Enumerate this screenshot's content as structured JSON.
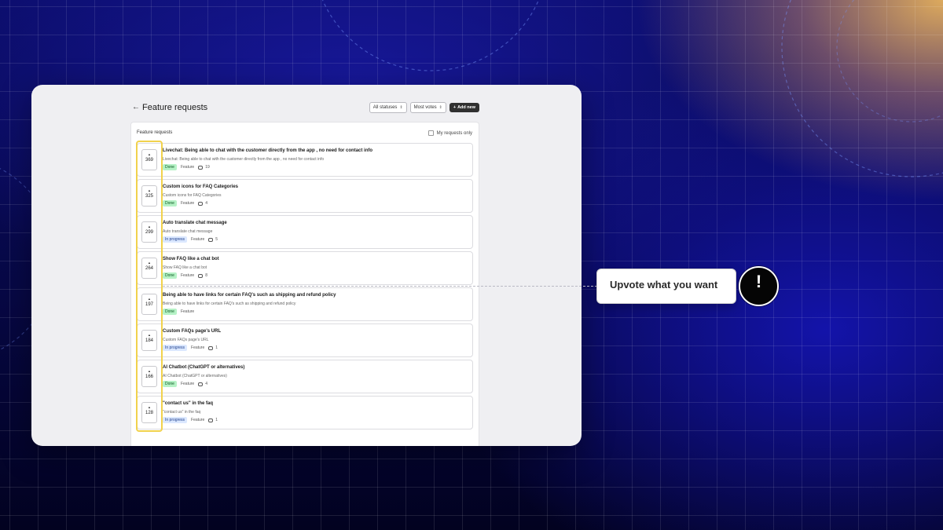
{
  "header": {
    "back_icon": "arrow-left-icon",
    "title": "Feature requests",
    "status_filter": "All statuses",
    "sort_filter": "Most votes",
    "add_button": "Add new"
  },
  "panel": {
    "title": "Feature requests",
    "my_requests_label": "My requests only"
  },
  "items": [
    {
      "votes": "369",
      "title": "Livechat: Being able to chat with the customer directly from the app , no need for contact info",
      "desc": "Livechat: Being able to chat with the customer directly from the app , no need for contact info",
      "status": "Done",
      "type": "Feature",
      "comments": "19"
    },
    {
      "votes": "325",
      "title": "Custom icons for FAQ Categories",
      "desc": "Custom icons for FAQ Categories",
      "status": "Done",
      "type": "Feature",
      "comments": "4"
    },
    {
      "votes": "299",
      "title": "Auto translate chat message",
      "desc": "Auto translate chat message",
      "status": "In progress",
      "type": "Feature",
      "comments": "5"
    },
    {
      "votes": "264",
      "title": "Show FAQ like a chat bot",
      "desc": "Show FAQ like a chat bot",
      "status": "Done",
      "type": "Feature",
      "comments": "8"
    },
    {
      "votes": "197",
      "title": "Being able to have links for certain FAQ's such as shipping and refund policy",
      "desc": "Being able to have links for certain FAQ's such as shipping and refund policy",
      "status": "Done",
      "type": "Feature",
      "comments": ""
    },
    {
      "votes": "184",
      "title": "Custom FAQs page's URL",
      "desc": "Custom FAQs page's URL",
      "status": "In progress",
      "type": "Feature",
      "comments": "1"
    },
    {
      "votes": "166",
      "title": "AI Chatbot (ChatGPT or alternatives)",
      "desc": "AI Chatbot (ChatGPT or alternatives)",
      "status": "Done",
      "type": "Feature",
      "comments": "4"
    },
    {
      "votes": "128",
      "title": "\"contact us\" in the faq",
      "desc": "\"contact us\" in the faq",
      "status": "In progress",
      "type": "Feature",
      "comments": "1"
    }
  ],
  "callout": {
    "text": "Upvote what you want",
    "icon": "exclamation-icon",
    "icon_glyph": "!"
  },
  "colors": {
    "highlight": "#f1d24d",
    "done_badge": "#b6f2c6",
    "in_progress_badge": "#dbe8ff"
  }
}
